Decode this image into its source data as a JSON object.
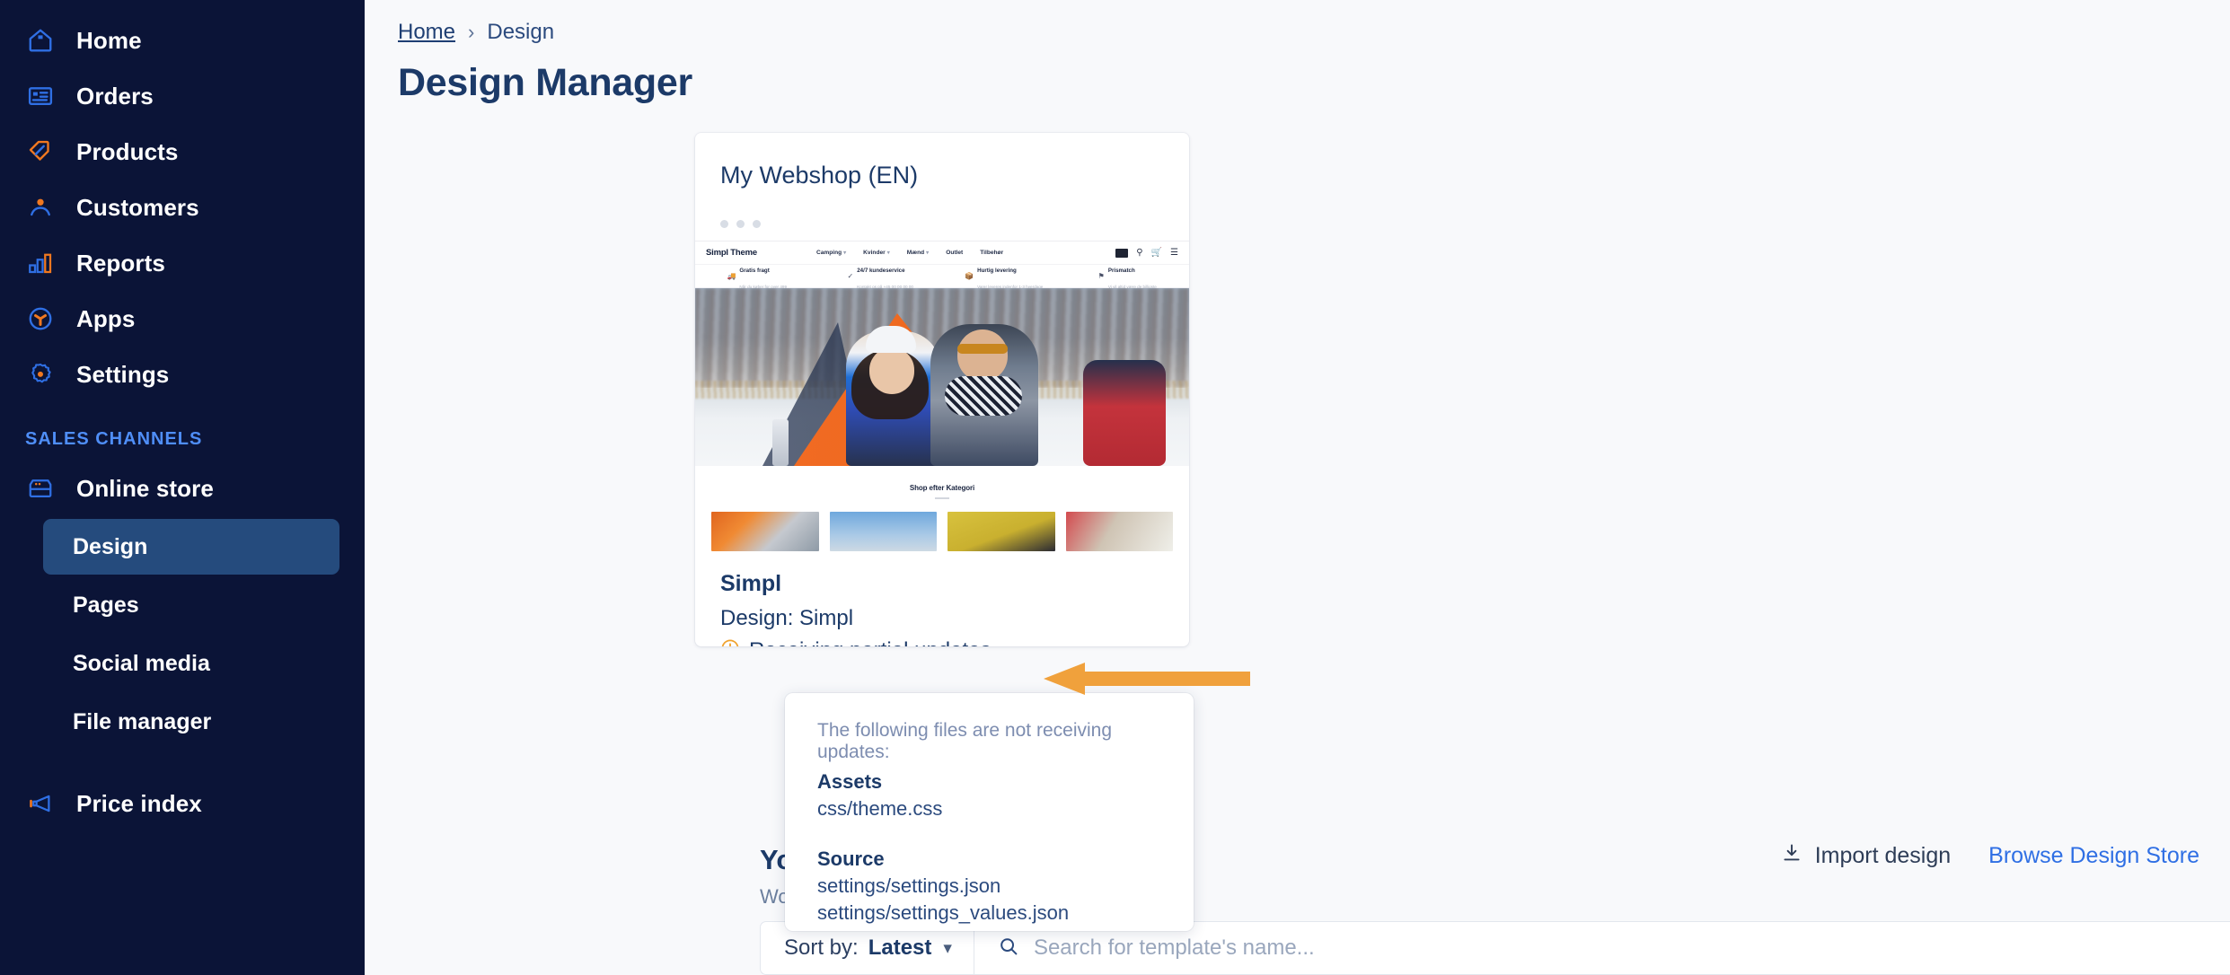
{
  "sidebar": {
    "items": [
      {
        "label": "Home",
        "icon": "home-icon"
      },
      {
        "label": "Orders",
        "icon": "orders-icon"
      },
      {
        "label": "Products",
        "icon": "products-tag-icon"
      },
      {
        "label": "Customers",
        "icon": "customers-person-icon"
      },
      {
        "label": "Reports",
        "icon": "reports-bar-chart-icon"
      },
      {
        "label": "Apps",
        "icon": "apps-icon"
      },
      {
        "label": "Settings",
        "icon": "settings-gear-icon"
      }
    ],
    "section_label": "SALES CHANNELS",
    "channel": {
      "label": "Online store",
      "icon": "online-store-icon"
    },
    "sub_items": [
      {
        "label": "Design",
        "active": true
      },
      {
        "label": "Pages",
        "active": false
      },
      {
        "label": "Social media",
        "active": false
      },
      {
        "label": "File manager",
        "active": false
      }
    ],
    "price_index": {
      "label": "Price index",
      "icon": "megaphone-icon"
    },
    "colors": {
      "background": "#0b1437",
      "active": "#254b7d",
      "section": "#4f8ef7",
      "icon": "#2f6fe4",
      "accent": "#f07820"
    }
  },
  "breadcrumb": {
    "home": "Home",
    "separator": "›",
    "current": "Design"
  },
  "page": {
    "title": "Design Manager"
  },
  "theme_card": {
    "shop_name": "My Webshop (EN)",
    "title": "Simpl",
    "design_label": "Design: Simpl",
    "status": "Receiving partial updates",
    "status_color": "#f0a22e",
    "preview_button": "preview-eye-icon"
  },
  "preview": {
    "logo": "Simpl Theme",
    "menu": [
      "Camping",
      "Kvinder",
      "Mænd",
      "Outlet",
      "Tilbehør"
    ],
    "usps": [
      {
        "title": "Gratis fragt",
        "sub": "Når du køber for over 499"
      },
      {
        "title": "24/7 kundeservice",
        "sub": "Kontakt os på +45 00 00 00 00"
      },
      {
        "title": "Hurtig levering",
        "sub": "Varer leveres indenfor 1-3 hverdage"
      },
      {
        "title": "Prismatch",
        "sub": "Vi vil altid være de billigste"
      }
    ],
    "category_heading": "Shop efter Kategori"
  },
  "popover": {
    "lead": "The following files are not receiving updates:",
    "groups": [
      {
        "heading": "Assets",
        "files": [
          "css/theme.css"
        ]
      },
      {
        "heading": "Source",
        "files": [
          "settings/settings.json",
          "settings/settings_values.json"
        ]
      }
    ]
  },
  "your_designs": {
    "title": "Your designs",
    "subtitle": "Work on the designs"
  },
  "actions": {
    "import_label": "Import design",
    "import_icon": "download-icon",
    "store_label": "Browse Design Store"
  },
  "filter_bar": {
    "sort_label": "Sort by:",
    "sort_value": "Latest",
    "chevron": "chevron-down-icon",
    "search_icon": "search-icon",
    "search_value": "",
    "search_placeholder": "Search for template's name..."
  }
}
